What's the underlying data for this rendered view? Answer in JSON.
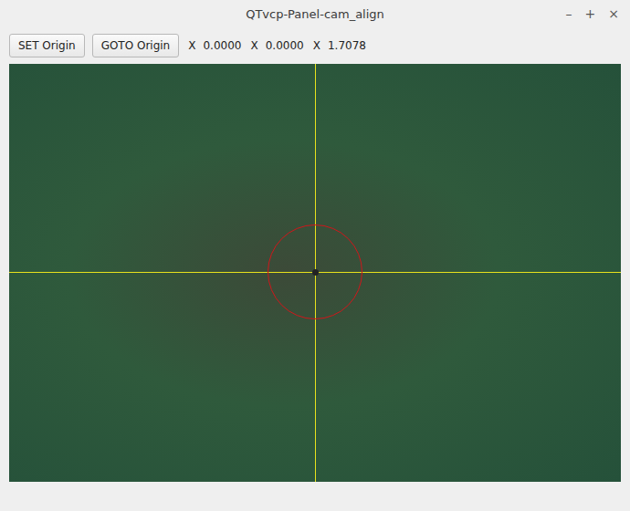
{
  "window": {
    "title": "QTvcp-Panel-cam_align",
    "controls": [
      "–",
      "+",
      "×"
    ]
  },
  "toolbar": {
    "buttons": [
      "SET Origin",
      "GOTO Origin"
    ],
    "readouts": [
      {
        "axis": "X",
        "value": "0.0000"
      },
      {
        "axis": "X",
        "value": "0.0000"
      },
      {
        "axis": "X",
        "value": "1.7078"
      }
    ]
  }
}
